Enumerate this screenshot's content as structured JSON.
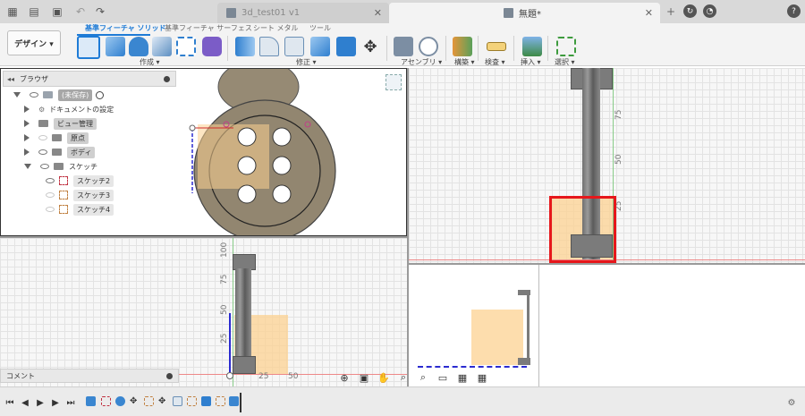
{
  "titlebar": {
    "tabs": [
      {
        "label": "3d_test01 v1",
        "active": false
      },
      {
        "label": "無題*",
        "active": true
      }
    ]
  },
  "toolbar": {
    "design_label": "デザイン ▾",
    "tabs": [
      "基準フィーチャ ソリッド",
      "基準フィーチャ サーフェス",
      "シート メタル",
      "ツール"
    ],
    "groups": [
      "作成 ▾",
      "修正 ▾",
      "アセンブリ ▾",
      "構築 ▾",
      "検査 ▾",
      "挿入 ▾",
      "選択 ▾"
    ]
  },
  "browser": {
    "title": "ブラウザ",
    "items": [
      {
        "label": "(未保存)"
      },
      {
        "label": "ドキュメントの設定"
      },
      {
        "label": "ビュー管理"
      },
      {
        "label": "原点"
      },
      {
        "label": "ボディ"
      },
      {
        "label": "スケッチ"
      },
      {
        "label": "スケッチ2"
      },
      {
        "label": "スケッチ3"
      },
      {
        "label": "スケッチ4"
      }
    ]
  },
  "viewport_tr": {
    "ticks": [
      "75",
      "50",
      "25"
    ]
  },
  "viewport_bl": {
    "ticks": [
      "100",
      "75",
      "50",
      "25"
    ],
    "xticks": [
      "25",
      "50"
    ]
  },
  "comment": {
    "label": "コメント"
  },
  "colors": {
    "accent": "#1e7bd6",
    "highlight": "#e6171b",
    "sketch_fill": "#fcd192",
    "toolbar_bg": "#f3f3f3"
  }
}
